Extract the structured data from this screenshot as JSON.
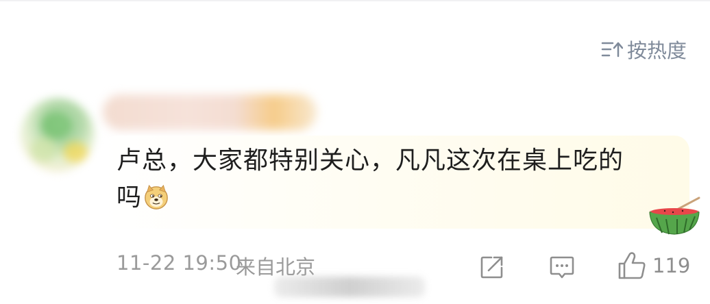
{
  "sort": {
    "label": "按热度",
    "icon": "sort-descending-icon"
  },
  "comment": {
    "avatar": "blurred-avatar",
    "username": "",
    "text_line1": "卢总，大家都特别关心，凡凡这次在桌上吃的",
    "text_line2": "吗",
    "emoji": "doge-icon",
    "badge": "watermelon-icon",
    "time": "11-22 19:50",
    "location": "来自北京",
    "like_count": "119"
  },
  "colors": {
    "text": "#1e1e1e",
    "meta": "#9a9a9a",
    "sort": "#7f8a9a",
    "bubble": "#fffbe8"
  }
}
